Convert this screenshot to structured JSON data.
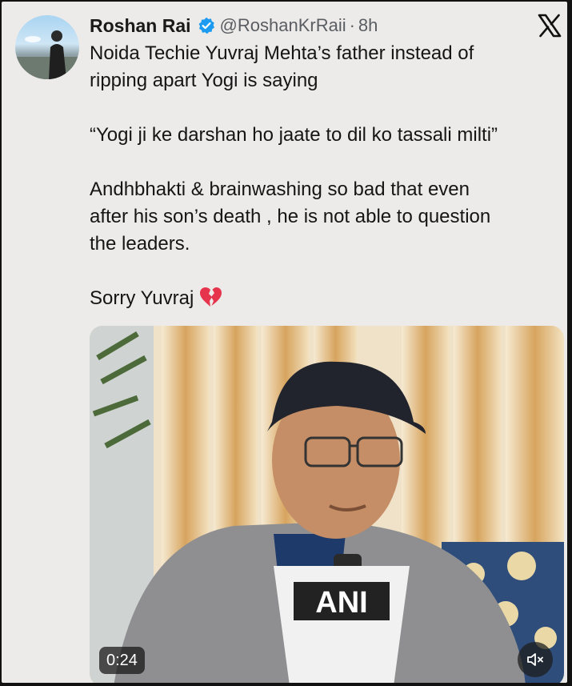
{
  "author": {
    "name": "Roshan Rai",
    "handle": "@RoshanKrRaii",
    "separator": "·",
    "time": "8h",
    "verified": true
  },
  "platform_icon": "x-logo-icon",
  "tweet": {
    "line1": "Noida Techie Yuvraj Mehta’s father  instead of",
    "line2": "ripping apart Yogi is saying",
    "quote": "“Yogi ji ke darshan ho jaate to dil ko tassali milti”",
    "para2_line1": "Andhbhakti & brainwashing so bad that even",
    "para2_line2": "after his son’s death , he is not able to question",
    "para2_line3": "the leaders.",
    "closing": "Sorry Yuvraj",
    "closing_emoji": "broken-heart-icon"
  },
  "video": {
    "duration": "0:24",
    "mic_label": "ANI",
    "muted": true
  },
  "colors": {
    "card_bg": "#ecebea",
    "verified_blue": "#1d9bf0",
    "muted_text": "#5a5d61"
  }
}
